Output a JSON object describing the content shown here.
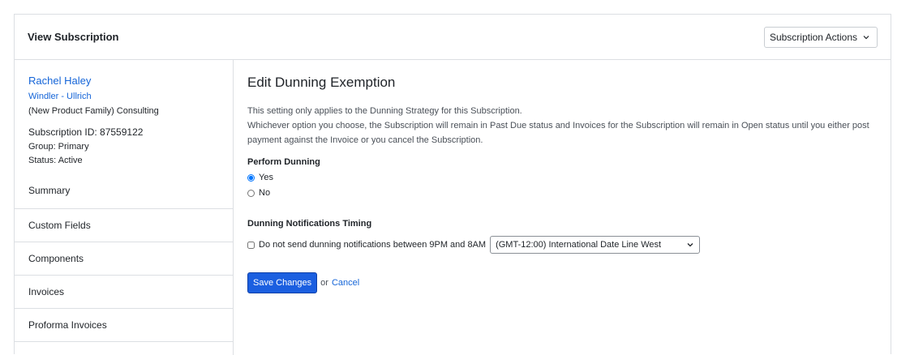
{
  "header": {
    "title": "View Subscription",
    "actions_label": "Subscription Actions",
    "actions_icon": "chevron-down-icon"
  },
  "sidebar": {
    "customer_name": "Rachel Haley",
    "company": "Windler - Ullrich",
    "product": "(New Product Family) Consulting",
    "subscription_id": "Subscription ID: 87559122",
    "group": "Group: Primary",
    "status": "Status: Active",
    "nav_items": [
      {
        "label": "Summary"
      },
      {
        "label": "Custom Fields"
      },
      {
        "label": "Components"
      },
      {
        "label": "Invoices"
      },
      {
        "label": "Proforma Invoices"
      }
    ]
  },
  "main": {
    "title": "Edit Dunning Exemption",
    "description_line1": "This setting only applies to the Dunning Strategy for this Subscription.",
    "description_line2": "Whichever option you choose, the Subscription will remain in Past Due status and Invoices for the Subscription will remain in Open status until you either post payment against the Invoice or you cancel the Subscription.",
    "perform_dunning_label": "Perform Dunning",
    "option_yes": "Yes",
    "option_no": "No",
    "selected_option": "Yes",
    "timing_label": "Dunning Notifications Timing",
    "checkbox_label": "Do not send dunning notifications between 9PM and 8AM",
    "checkbox_checked": false,
    "timezone_value": "(GMT-12:00) International Date Line West",
    "save_label": "Save Changes",
    "or_text": "or",
    "cancel_label": "Cancel"
  },
  "colors": {
    "link": "#1565d8",
    "primary_button": "#1b5fe0",
    "border": "#dcdfe3"
  }
}
